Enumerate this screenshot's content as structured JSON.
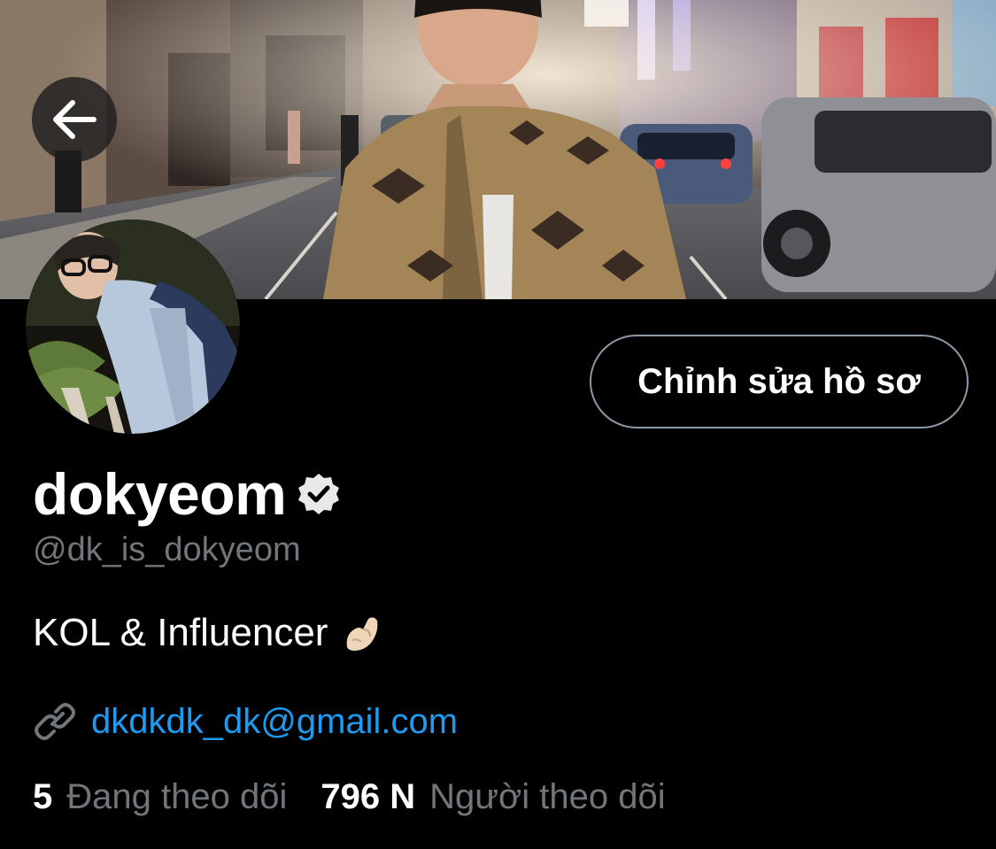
{
  "header": {
    "back_icon": "arrow-left-icon"
  },
  "profile": {
    "display_name": "dokyeom",
    "verified_icon": "verified-badge-icon",
    "handle": "@dk_is_dokyeom",
    "bio": "KOL & Influencer",
    "bio_emoji": "pinching-hand-emoji",
    "link_icon": "link-icon",
    "link": "dkdkdk_dk@gmail.com",
    "edit_button_label": "Chỉnh sửa hồ sơ"
  },
  "stats": {
    "following_count": "5",
    "following_label": "Đang theo dõi",
    "followers_count": "796 N",
    "followers_label": "Người theo dõi"
  },
  "colors": {
    "background": "#000000",
    "link": "#1d9bf0",
    "muted": "#71767b",
    "button_border": "#8b98a5"
  }
}
